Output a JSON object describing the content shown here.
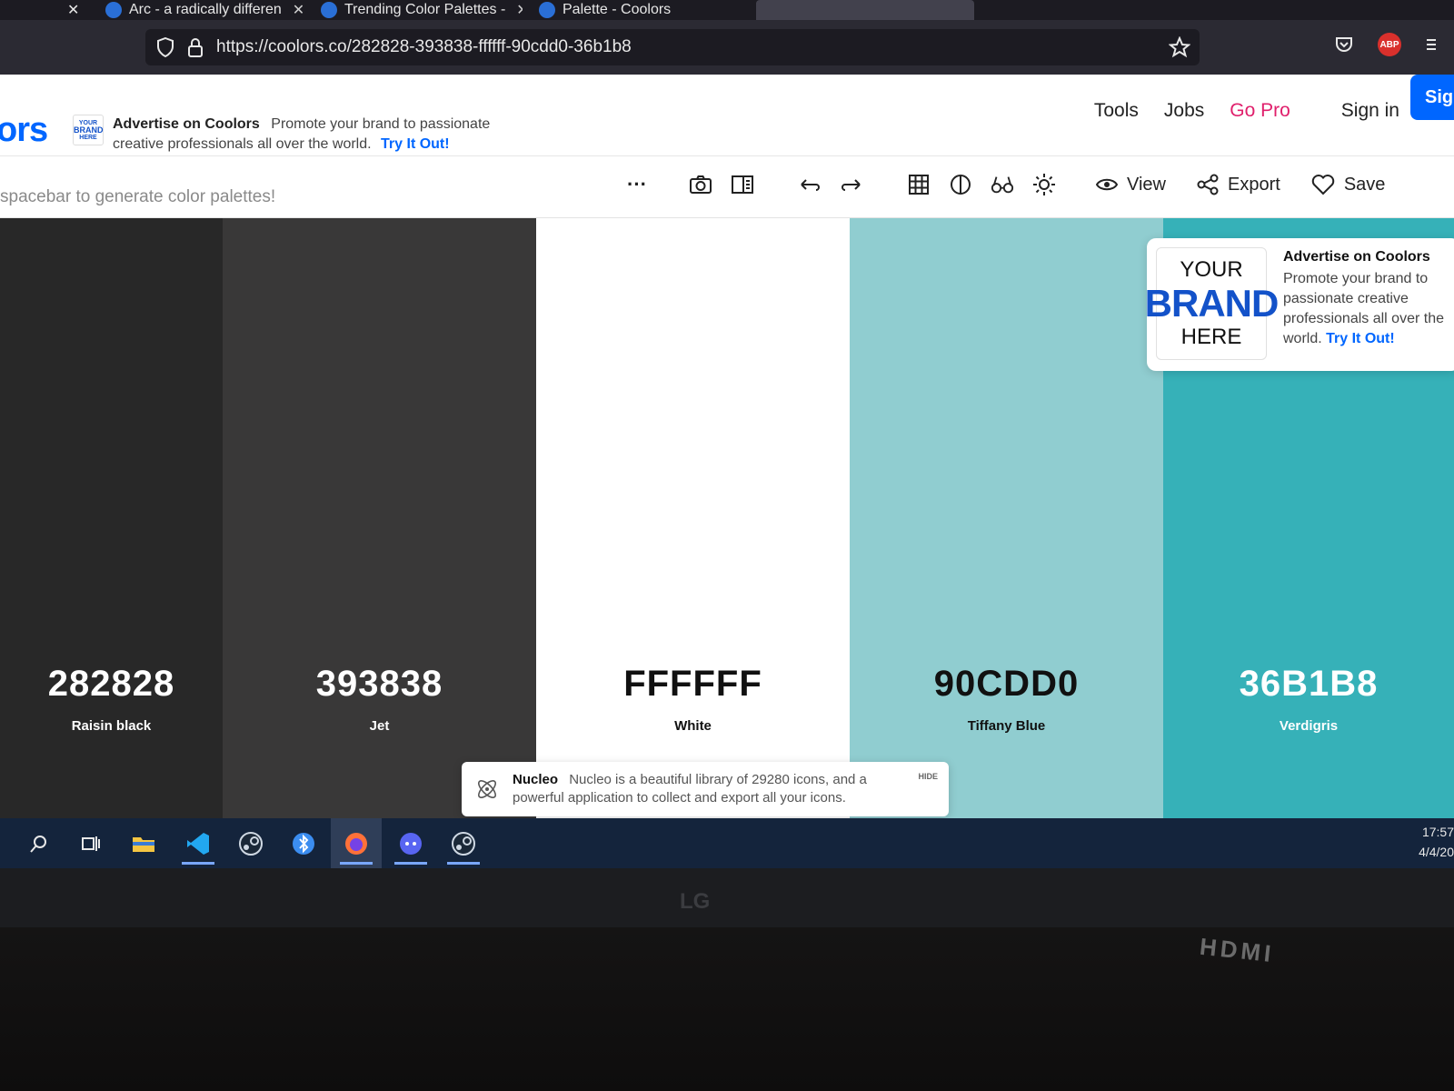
{
  "browser": {
    "tabs": [
      {
        "title": "Arc - a radically differen"
      },
      {
        "title": "Trending Color Palettes -"
      },
      {
        "title": "Palette - Coolors"
      }
    ],
    "url": "https://coolors.co/282828-393838-ffffff-90cdd0-36b1b8"
  },
  "header": {
    "logo_fragment": "ors",
    "ad": {
      "brand_mini": [
        "YOUR",
        "BRAND",
        "HERE"
      ],
      "title": "Advertise on Coolors",
      "body": "Promote your brand to passionate creative professionals all over the world.",
      "link": "Try It Out!"
    },
    "nav": {
      "tools": "Tools",
      "jobs": "Jobs",
      "pro": "Go Pro",
      "signin": "Sign in",
      "signup": "Sig"
    }
  },
  "toolbar": {
    "hint": "spacebar to generate color palettes!",
    "more": "···",
    "view_label": "View",
    "export_label": "Export",
    "save_label": "Save"
  },
  "palette": {
    "colors": [
      {
        "hex": "282828",
        "name": "Raisin black",
        "color": "#282828",
        "text_color": "#ffffff"
      },
      {
        "hex": "393838",
        "name": "Jet",
        "color": "#393838",
        "text_color": "#ffffff"
      },
      {
        "hex": "FFFFFF",
        "name": "White",
        "color": "#ffffff",
        "text_color": "#111111"
      },
      {
        "hex": "90CDD0",
        "name": "Tiffany Blue",
        "color": "#90cdd0",
        "text_color": "#111111"
      },
      {
        "hex": "36B1B8",
        "name": "Verdigris",
        "color": "#36b1b8",
        "text_color": "#ffffff"
      }
    ]
  },
  "ad_card": {
    "brand": {
      "line1": "YOUR",
      "line2": "BRAND",
      "line3": "HERE"
    },
    "title": "Advertise on Coolors",
    "body": "Promote your brand to passionate creative professionals all over the world.",
    "link": "Try It Out!"
  },
  "nucleo": {
    "title": "Nucleo",
    "body": "Nucleo is a beautiful library of 29280 icons, and a powerful application to collect and export all your icons.",
    "hide": "HIDE"
  },
  "taskbar": {
    "time": "17:57",
    "date": "4/4/20"
  },
  "monitor": {
    "brand": "LG",
    "port": "HDMI"
  },
  "colors": {
    "accent": "#0066ff",
    "pro": "#e0206c"
  }
}
